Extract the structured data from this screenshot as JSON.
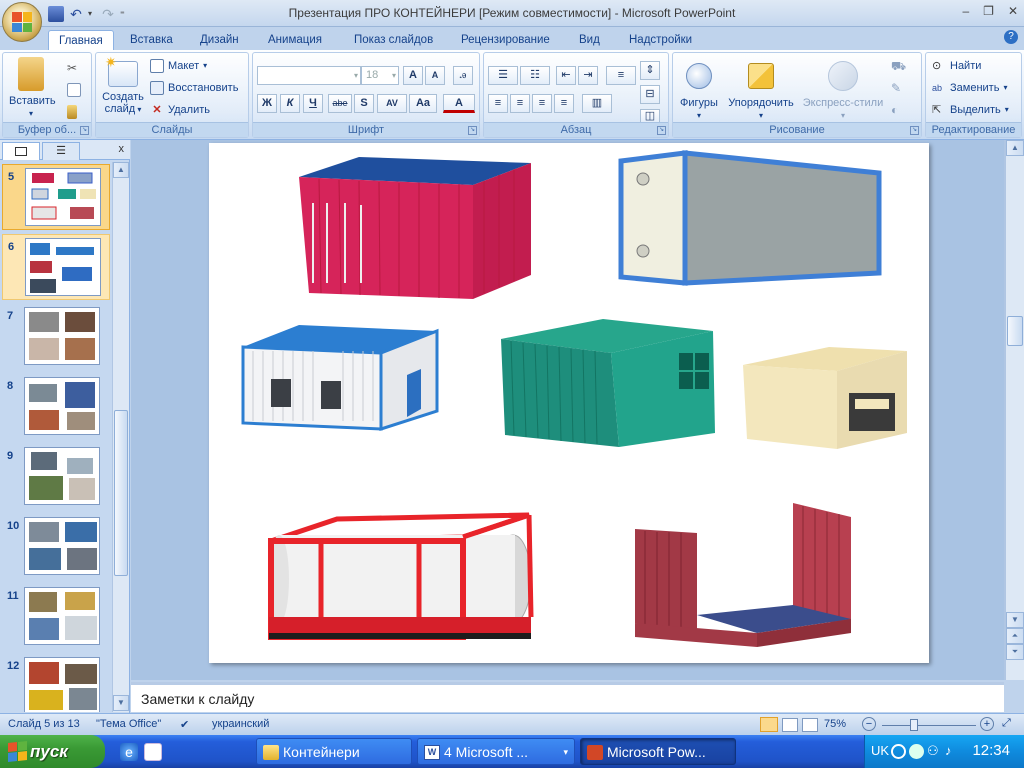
{
  "window": {
    "title": "Презентация ПРО КОНТЕЙНЕРИ [Режим совместимости] - Microsoft PowerPoint"
  },
  "tabs": [
    "Главная",
    "Вставка",
    "Дизайн",
    "Анимация",
    "Показ слайдов",
    "Рецензирование",
    "Вид",
    "Надстройки"
  ],
  "ribbon": {
    "clipboard": {
      "label": "Буфер об...",
      "paste": "Вставить"
    },
    "slides": {
      "label": "Слайды",
      "new_slide_line1": "Создать",
      "new_slide_line2": "слайд",
      "layout": "Макет",
      "reset": "Восстановить",
      "delete": "Удалить"
    },
    "font": {
      "label": "Шрифт",
      "font_name": "",
      "font_size": "18",
      "bold": "Ж",
      "italic": "К",
      "underline": "Ч",
      "strike": "abe",
      "shadow": "S",
      "spacing": "AV",
      "case": "Aa",
      "color": "A",
      "grow": "A",
      "shrink": "A"
    },
    "paragraph": {
      "label": "Абзац"
    },
    "drawing": {
      "label": "Рисование",
      "shapes": "Фигуры",
      "arrange": "Упорядочить",
      "quick_styles": "Экспресс-стили"
    },
    "editing": {
      "label": "Редактирование",
      "find": "Найти",
      "replace": "Заменить",
      "select": "Выделить"
    }
  },
  "slides_panel": {
    "thumbnails": [
      {
        "num": "5",
        "selected": true
      },
      {
        "num": "6",
        "selected": false
      },
      {
        "num": "7"
      },
      {
        "num": "8"
      },
      {
        "num": "9"
      },
      {
        "num": "10"
      },
      {
        "num": "11"
      },
      {
        "num": "12"
      }
    ]
  },
  "notes": {
    "placeholder": "Заметки к слайду"
  },
  "status": {
    "slide": "Слайд 5 из 13",
    "theme": "\"Тема Office\"",
    "language": "украинский",
    "zoom": "75%"
  },
  "taskbar": {
    "start": "пуск",
    "items": [
      {
        "label": "Контейнери"
      },
      {
        "label": "4 Microsoft ..."
      },
      {
        "label": "Microsoft Pow..."
      }
    ],
    "lang": "UK",
    "time": "12:34"
  },
  "colors": {
    "accent": "#15428b",
    "ribbon_bg": "#dbe8f7",
    "selected_thumb": "#fad78a"
  }
}
